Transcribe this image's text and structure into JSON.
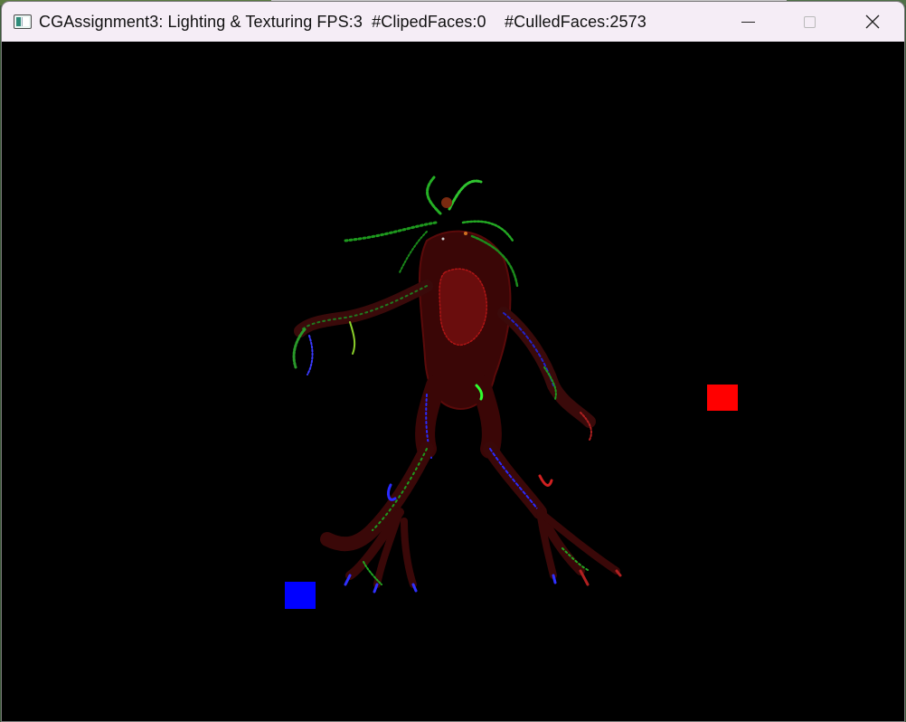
{
  "window": {
    "title": "CGAssignment3: Lighting & Texturing FPS:3  #ClipedFaces:0    #CulledFaces:2573",
    "controls": {
      "minimize_icon": "minimize-icon",
      "maximize_icon": "maximize-icon",
      "close_icon": "close-icon"
    }
  },
  "viewport": {
    "background": "#000000",
    "lights": [
      {
        "name": "red-light-cube",
        "color": "#ff0000"
      },
      {
        "name": "blue-light-cube",
        "color": "#0000ff"
      }
    ],
    "model": {
      "name": "textured-creature-model",
      "colors": [
        "#ff2020",
        "#20ff20",
        "#3030ff"
      ]
    }
  }
}
